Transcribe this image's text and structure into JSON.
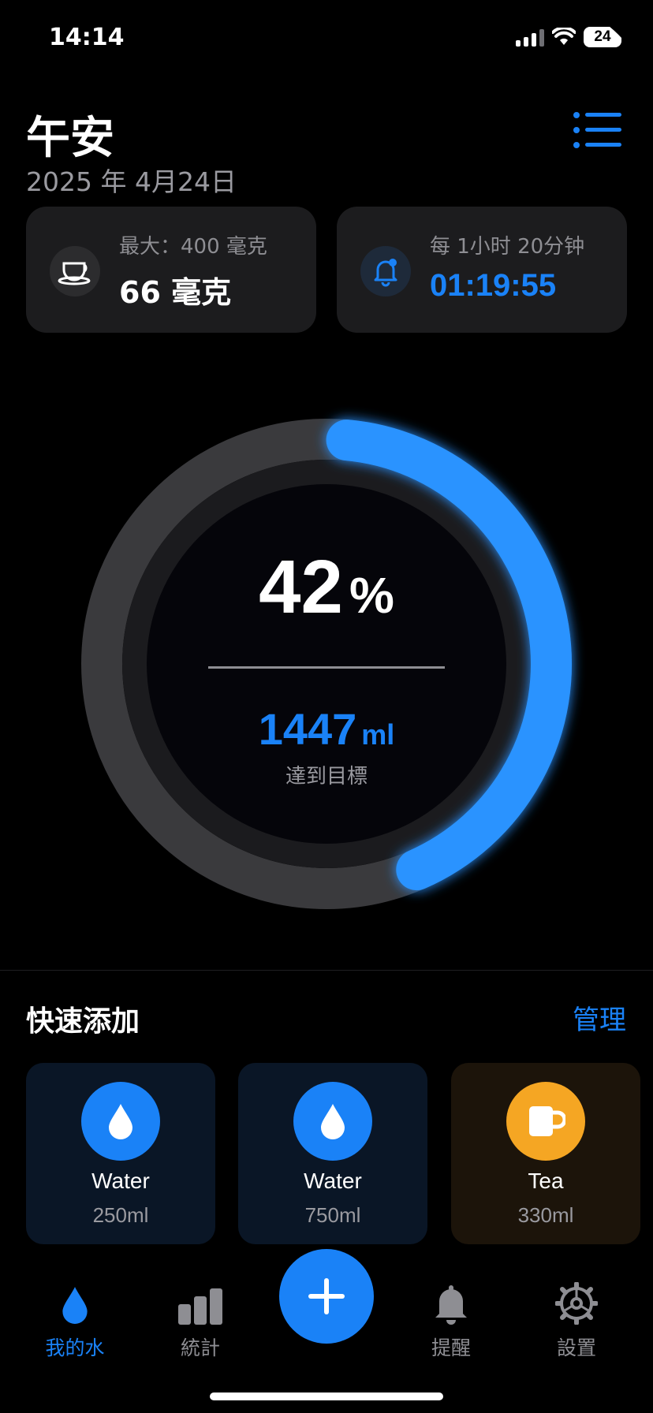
{
  "status_bar": {
    "time": "14:14",
    "battery": "24"
  },
  "header": {
    "greeting": "午安",
    "date": "2025 年 4月24日"
  },
  "cards": {
    "max": {
      "label": "最大：400 毫克",
      "value": "66 毫克"
    },
    "reminder": {
      "label": "每 1小时 20分钟",
      "value": "01:19:55"
    }
  },
  "progress": {
    "percent_value": 0.42,
    "percent_text": "42",
    "percent_unit": "%",
    "amount": "1447",
    "amount_unit": "ml",
    "subtitle": "達到目標"
  },
  "quick_add": {
    "title": "快速添加",
    "manage_label": "管理",
    "items": [
      {
        "name": "Water",
        "amount": "250ml",
        "icon": "water-drop-icon",
        "color": "#1a82f7"
      },
      {
        "name": "Water",
        "amount": "750ml",
        "icon": "water-drop-icon",
        "color": "#1a82f7"
      },
      {
        "name": "Tea",
        "amount": "330ml",
        "icon": "mug-icon",
        "color": "#f5a623"
      }
    ]
  },
  "tabs": [
    {
      "label": "我的水",
      "icon": "water-drop-icon",
      "active": true
    },
    {
      "label": "統計",
      "icon": "bar-chart-icon",
      "active": false
    },
    {
      "label": "提醒",
      "icon": "bell-icon",
      "active": false
    },
    {
      "label": "設置",
      "icon": "gear-icon",
      "active": false
    }
  ],
  "colors": {
    "accent": "#1a82f7",
    "tea": "#f5a623",
    "card": "#1c1c1e"
  }
}
